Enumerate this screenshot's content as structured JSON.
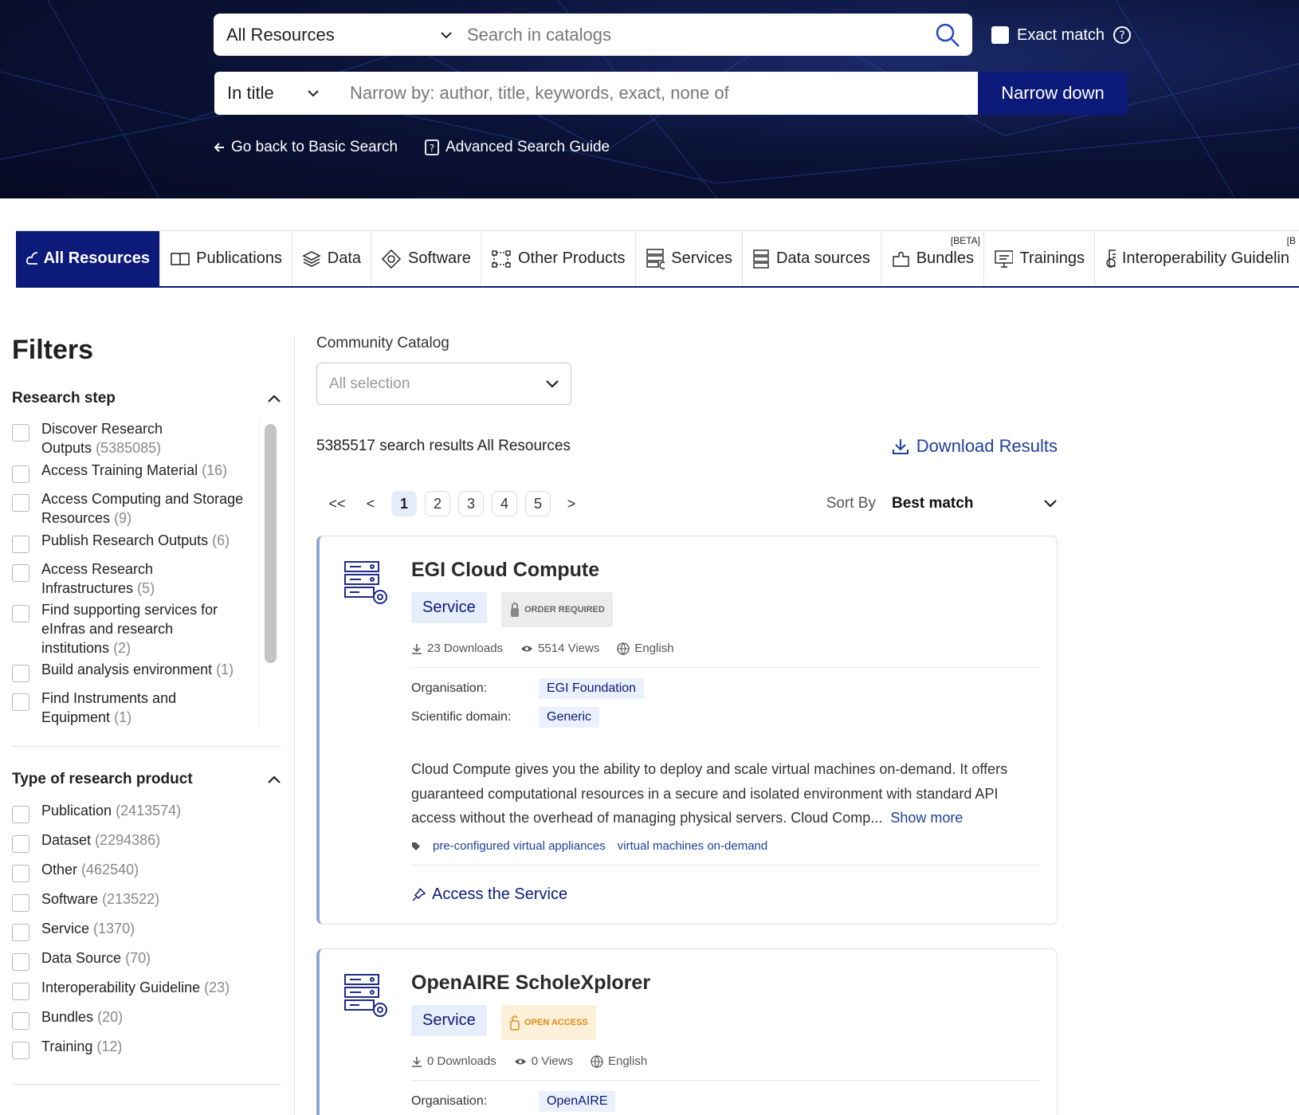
{
  "search": {
    "resource_select": "All Resources",
    "placeholder": "Search in catalogs",
    "exact_match": "Exact match",
    "narrow_field": "In title",
    "narrow_placeholder": "Narrow by: author, title, keywords, exact, none of",
    "narrow_button": "Narrow down",
    "back_link": "Go back to Basic Search",
    "guide_link": "Advanced Search Guide"
  },
  "tabs": [
    {
      "label": "All Resources",
      "icon": "cloud-icon"
    },
    {
      "label": "Publications",
      "icon": "book-icon"
    },
    {
      "label": "Data",
      "icon": "layers-icon"
    },
    {
      "label": "Software",
      "icon": "software-icon"
    },
    {
      "label": "Other Products",
      "icon": "nodes-icon"
    },
    {
      "label": "Services",
      "icon": "server-gear-icon"
    },
    {
      "label": "Data sources",
      "icon": "database-icon"
    },
    {
      "label": "Bundles",
      "icon": "puzzle-icon",
      "beta": "[BETA]"
    },
    {
      "label": "Trainings",
      "icon": "monitor-icon"
    },
    {
      "label": "Interoperability Guidelin",
      "icon": "guideline-icon",
      "beta": "[B"
    }
  ],
  "filters": {
    "title": "Filters",
    "research_step": {
      "title": "Research step",
      "items": [
        {
          "label": "Discover Research Outputs",
          "lines": [
            "Discover Research",
            "Outputs"
          ],
          "count": "(5385085)"
        },
        {
          "label": "Access Training Material",
          "count": "(16)"
        },
        {
          "label": "Access Computing and Storage Resources",
          "lines": [
            "Access Computing and Storage",
            "Resources"
          ],
          "count": "(9)"
        },
        {
          "label": "Publish Research Outputs",
          "count": "(6)"
        },
        {
          "label": "Access Research Infrastructures",
          "lines": [
            "Access Research",
            "Infrastructures"
          ],
          "count": "(5)"
        },
        {
          "label": "Find supporting services for eInfras and research institutions",
          "lines": [
            "Find supporting services for",
            "eInfras and research",
            "institutions"
          ],
          "count": "(2)"
        },
        {
          "label": "Build analysis environment",
          "count": "(1)"
        },
        {
          "label": "Find Instruments and Equipment",
          "lines": [
            "Find Instruments and",
            "Equipment"
          ],
          "count": "(1)"
        }
      ]
    },
    "product_type": {
      "title": "Type of research product",
      "items": [
        {
          "label": "Publication",
          "count": "(2413574)"
        },
        {
          "label": "Dataset",
          "count": "(2294386)"
        },
        {
          "label": "Other",
          "count": "(462540)"
        },
        {
          "label": "Software",
          "count": "(213522)"
        },
        {
          "label": "Service",
          "count": "(1370)"
        },
        {
          "label": "Data Source",
          "count": "(70)"
        },
        {
          "label": "Interoperability Guideline",
          "count": "(23)"
        },
        {
          "label": "Bundles",
          "count": "(20)"
        },
        {
          "label": "Training",
          "count": "(12)"
        }
      ]
    }
  },
  "main": {
    "catalog_label": "Community Catalog",
    "catalog_select": "All selection",
    "results_text": "5385517 search results All Resources",
    "download": "Download Results",
    "pager": {
      "first": "<<",
      "prev": "<",
      "pages": [
        "1",
        "2",
        "3",
        "4",
        "5"
      ],
      "current": "1",
      "next": ">"
    },
    "sort_label": "Sort By",
    "sort_value": "Best match"
  },
  "results": [
    {
      "title": "EGI Cloud Compute",
      "type": "Service",
      "access": "ORDER REQUIRED",
      "downloads": "23 Downloads",
      "views": "5514 Views",
      "language": "English",
      "organisation_label": "Organisation:",
      "organisation": "EGI Foundation",
      "domain_label": "Scientific domain:",
      "domain": "Generic",
      "description": "Cloud Compute gives you the ability to deploy and scale virtual machines on-demand. It offers guaranteed computational resources in a secure and isolated environment with standard API access without the overhead of managing physical servers. Cloud Comp...",
      "show_more": "Show more",
      "tags": [
        "pre-configured virtual appliances",
        "virtual machines on-demand"
      ],
      "action": "Access the Service"
    },
    {
      "title": "OpenAIRE ScholeXplorer",
      "type": "Service",
      "access": "OPEN ACCESS",
      "downloads": "0 Downloads",
      "views": "0 Views",
      "language": "English",
      "organisation_label": "Organisation:",
      "organisation": "OpenAIRE"
    }
  ],
  "colors": {
    "brand": "#0c1a7a",
    "link": "#1e3fa0",
    "open_access": "#e08a18"
  }
}
